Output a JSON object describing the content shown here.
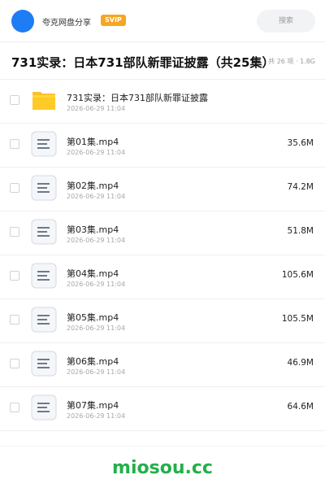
{
  "header": {
    "brand": "夸克网盘分享",
    "badge": "SVIP",
    "search_placeholder": "搜索",
    "avatar_color": "#1e7cf5",
    "badge_color": "#f5a623"
  },
  "share": {
    "title": "731实录：日本731部队新罪证披露（共25集）",
    "meta": "共 26 项 · 1.8G"
  },
  "files": [
    {
      "name": "731实录：日本731部队新罪证披露",
      "date": "2026-06-29 11:04",
      "size": "",
      "icon": "folder-icon"
    },
    {
      "name": "第01集.mp4",
      "date": "2026-06-29 11:04",
      "size": "35.6M",
      "icon": "file-icon"
    },
    {
      "name": "第02集.mp4",
      "date": "2026-06-29 11:04",
      "size": "74.2M",
      "icon": "file-icon"
    },
    {
      "name": "第03集.mp4",
      "date": "2026-06-29 11:04",
      "size": "51.8M",
      "icon": "file-icon"
    },
    {
      "name": "第04集.mp4",
      "date": "2026-06-29 11:04",
      "size": "105.6M",
      "icon": "file-icon"
    },
    {
      "name": "第05集.mp4",
      "date": "2026-06-29 11:04",
      "size": "105.5M",
      "icon": "file-icon"
    },
    {
      "name": "第06集.mp4",
      "date": "2026-06-29 11:04",
      "size": "46.9M",
      "icon": "file-icon"
    },
    {
      "name": "第07集.mp4",
      "date": "2026-06-29 11:04",
      "size": "64.6M",
      "icon": "file-icon"
    }
  ],
  "footer": {
    "watermark": "miosou.cc",
    "watermark_color": "#22b04a"
  }
}
